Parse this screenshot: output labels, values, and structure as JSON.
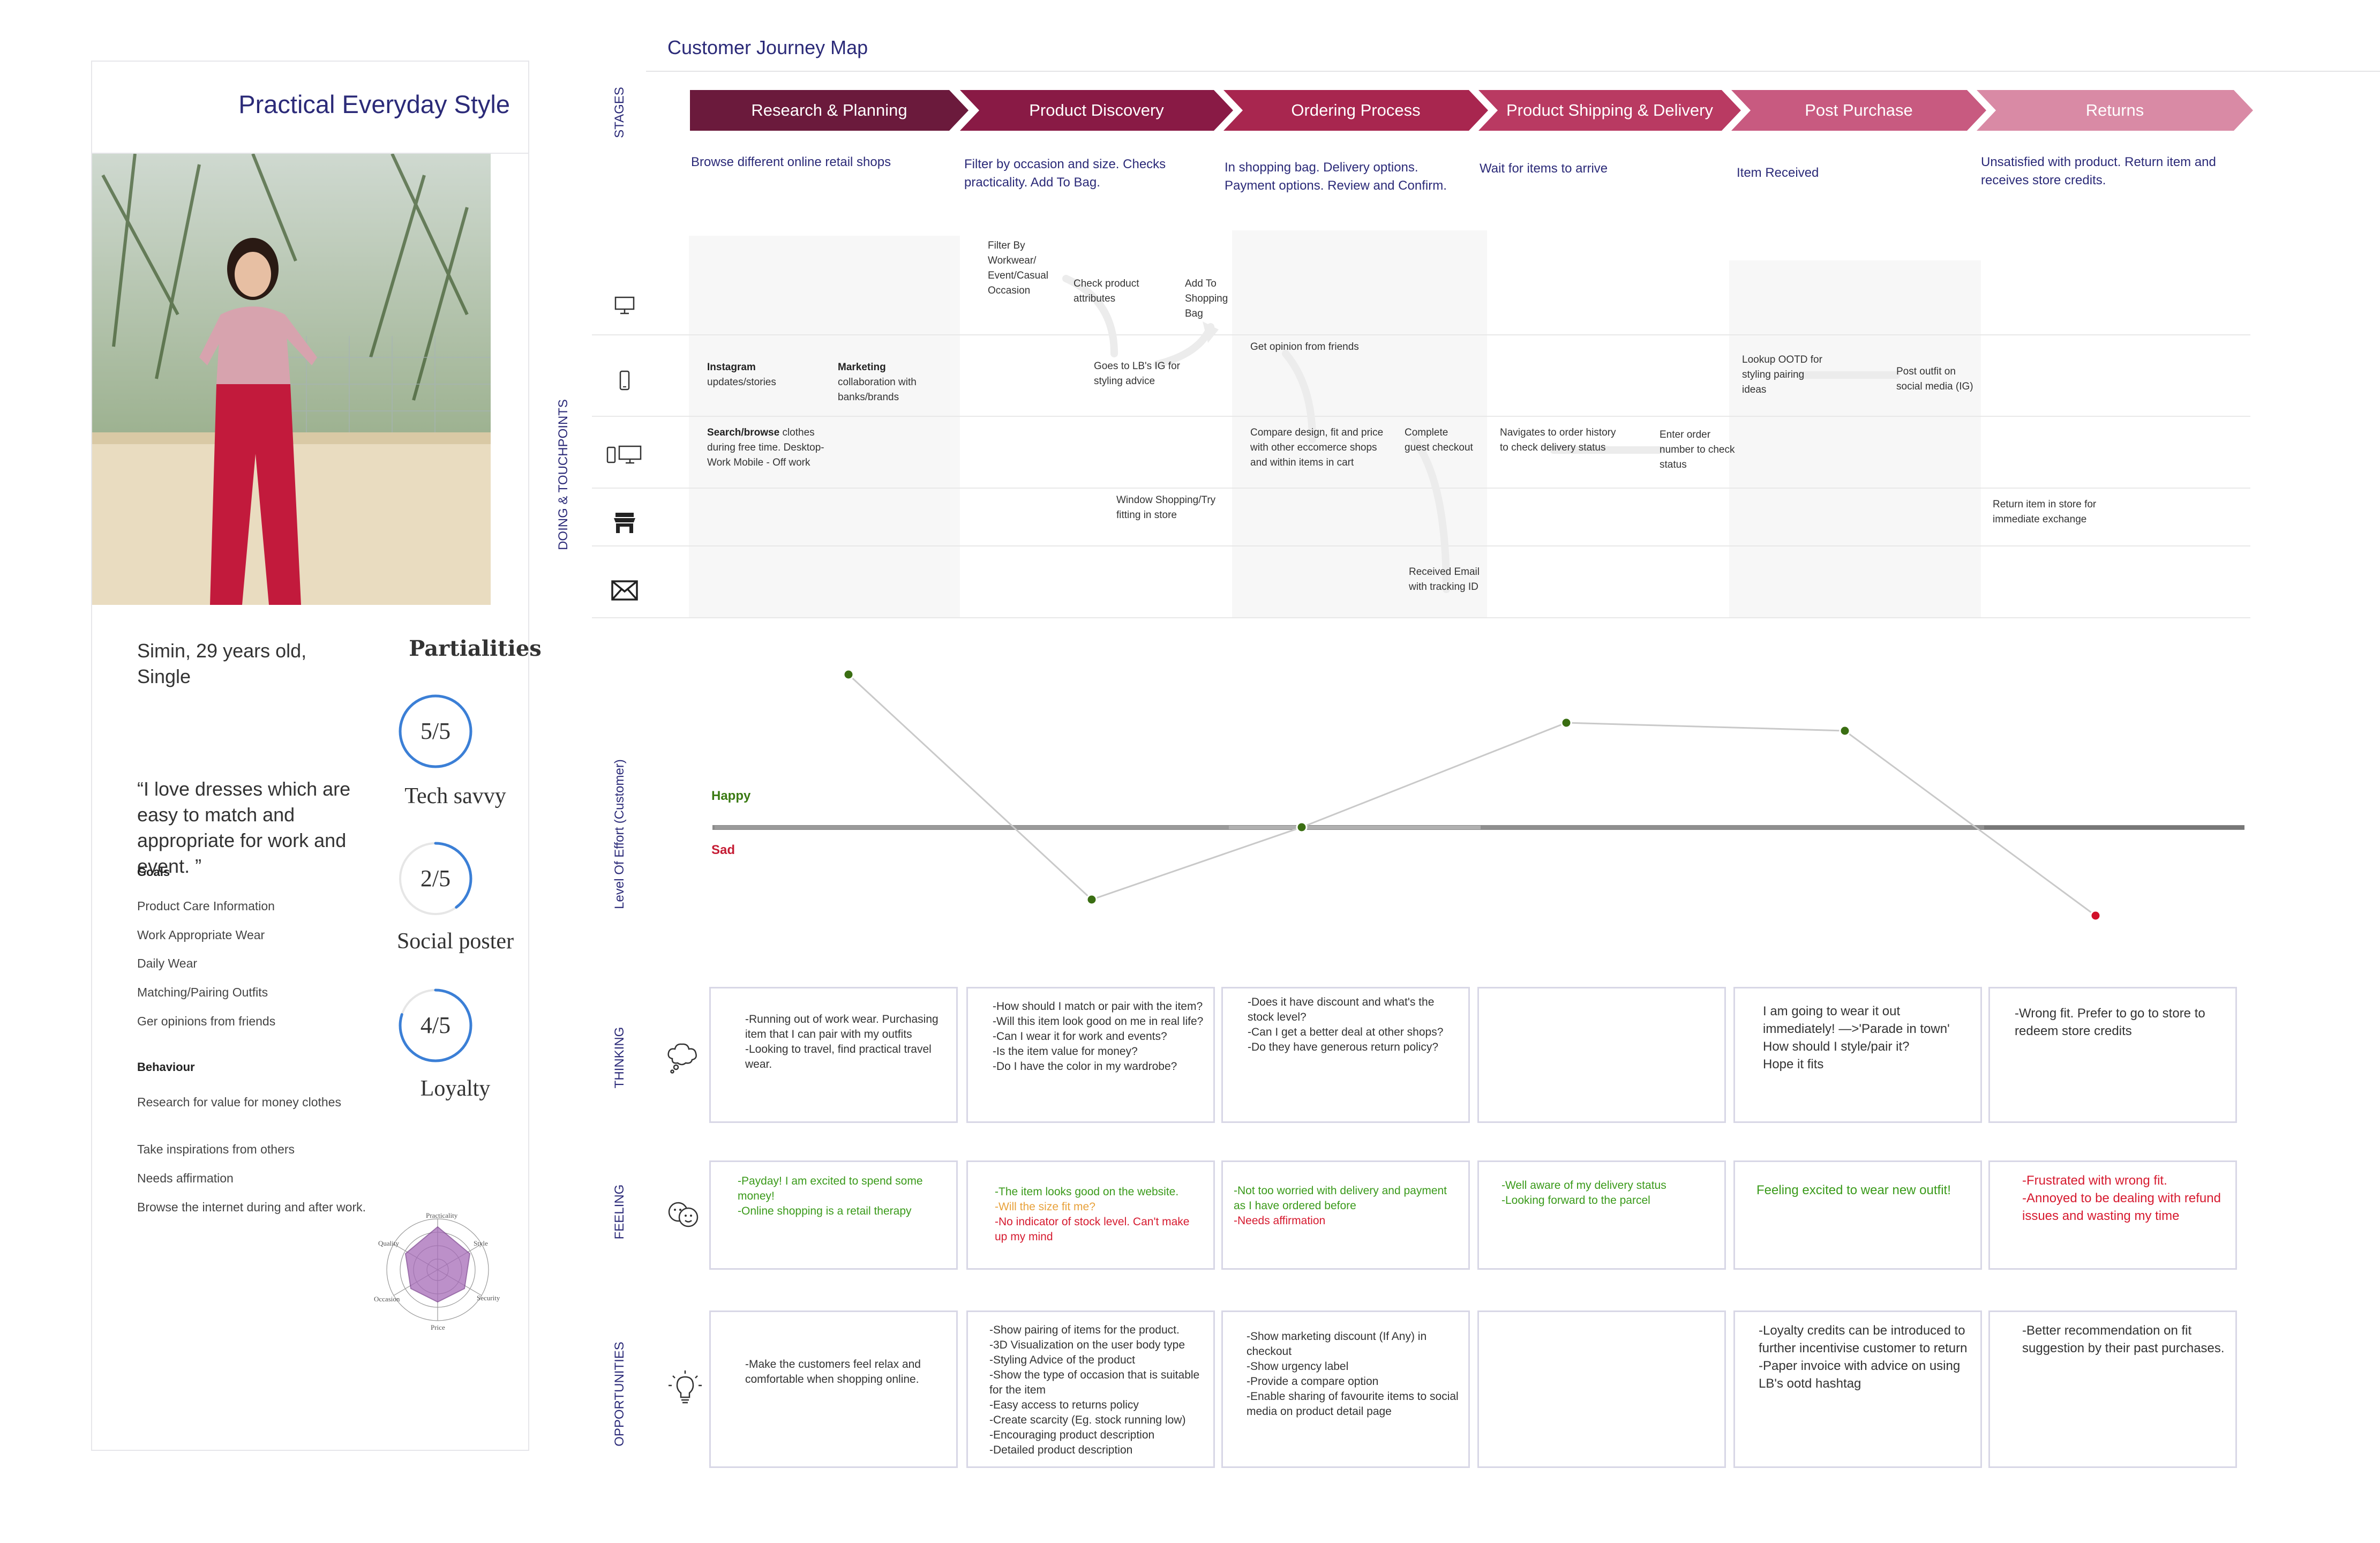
{
  "persona": {
    "title": "Practical Everyday Style",
    "name": "Simin, 29 years old, Single",
    "quote": "“I love dresses which are easy to match and appropriate for work and event. ”",
    "goals_heading": "Goals",
    "goals": [
      "Product Care Information",
      "Work Appropriate Wear",
      "Daily Wear",
      "Matching/Pairing Outfits",
      "Ger opinions from friends"
    ],
    "behaviour_heading": "Behaviour",
    "behaviours": [
      "Research for value for money clothes",
      "Take inspirations from others",
      "Needs affirmation",
      "Browse the internet during and after work."
    ],
    "partialities_title": "Partialities",
    "partialities": [
      {
        "score": "5/5",
        "label": "Tech savvy",
        "value": 1.0
      },
      {
        "score": "2/5",
        "label": "Social poster",
        "value": 0.4
      },
      {
        "score": "4/5",
        "label": "Loyalty",
        "value": 0.8
      }
    ],
    "radar_labels": [
      "Practicality",
      "Style",
      "Security",
      "Price",
      "Occasion",
      "Quality"
    ],
    "accent": "#3b7fd6"
  },
  "map": {
    "title": "Customer Journey Map",
    "row_labels": {
      "stages": "STAGES",
      "touchpoints": "DOING & TOUCHPOINTS",
      "effort": "Level Of Effort (Customer)",
      "thinking": "THINKING",
      "feeling": "FEELING",
      "opportunities": "OPPORTUNITIES"
    },
    "stages": [
      {
        "name": "Research & Planning",
        "color": "#6b1a3c",
        "desc": "Browse different online retail shops"
      },
      {
        "name": "Product Discovery",
        "color": "#891a45",
        "desc": "Filter by occasion and size. Checks practicality. Add To Bag."
      },
      {
        "name": "Ordering Process",
        "color": "#a8264f",
        "desc": "In shopping bag. Delivery options. Payment options. Review and Confirm."
      },
      {
        "name": "Product Shipping & Delivery",
        "color": "#b93a62",
        "desc": "Wait for items to arrive"
      },
      {
        "name": "Post Purchase",
        "color": "#c85a80",
        "desc": "Item Received"
      },
      {
        "name": "Returns",
        "color": "#d98aa5",
        "desc": "Unsatisfied with product. Return item and receives store credits."
      }
    ],
    "touchpoints": {
      "instagram_title": "Instagram",
      "instagram_text": "updates/stories",
      "marketing_title": "Marketing",
      "marketing_text": "collaboration with banks/brands",
      "search_title": "Search/browse",
      "search_text": "clothes during free time. Desktop- Work Mobile - Off work",
      "filter": "Filter By Workwear/ Event/Casual Occasion",
      "check_attr": "Check product attributes",
      "add_bag": "Add To Shopping Bag",
      "goes_ig": "Goes to LB's IG for styling advice",
      "window_shop": "Window Shopping/Try fitting in store",
      "opinion": "Get opinion from friends",
      "compare": "Compare design, fit and price with other eccomerce shops and within items in cart",
      "guest": "Complete guest checkout",
      "email": "Received Email with tracking ID",
      "navigate": "Navigates to order history to check delivery status",
      "order_num": "Enter order number to check status",
      "ootd": "Lookup OOTD for styling pairing ideas",
      "post_outfit": "Post outfit on social media (IG)",
      "return_store": "Return item in store for immediate exchange"
    },
    "emotion": {
      "happy_label": "Happy",
      "sad_label": "Sad",
      "points": [
        0.95,
        -0.45,
        0.0,
        0.65,
        0.6,
        -0.55
      ],
      "colors": {
        "positive": "#3a6e12",
        "negative": "#d1102a"
      }
    },
    "thinking": [
      "-Running out of work wear. Purchasing item that I can pair with my outfits\n-Looking to travel, find practical travel wear.",
      "-How should I match or pair with the item?\n-Will this item look good on me in real life?\n-Can I wear it for work and events?\n-Is the item value for money?\n-Do I have the color in my wardrobe?",
      "-Does it have discount and what's the stock level?\n-Can I get a better deal at other shops?\n-Do they have generous return policy?",
      "",
      "I am going to wear it out immediately! —>'Parade in town'\nHow should I style/pair it?\nHope it fits",
      "-Wrong fit. Prefer to go to store to redeem store credits"
    ],
    "feeling": [
      {
        "lines": [
          {
            "t": "-Payday! I am excited to spend some money!\n-Online shopping is a retail therapy",
            "c": "green"
          }
        ]
      },
      {
        "lines": [
          {
            "t": "-The item looks good on the website.",
            "c": "green"
          },
          {
            "t": "-Will the size fit me?",
            "c": "orange"
          },
          {
            "t": "-No indicator of stock level. Can't make up my mind",
            "c": "red"
          }
        ]
      },
      {
        "lines": [
          {
            "t": "-Not too worried with delivery and payment as I have ordered before",
            "c": "green"
          },
          {
            "t": "-Needs affirmation",
            "c": "red"
          }
        ]
      },
      {
        "lines": [
          {
            "t": "-Well aware of my delivery status\n-Looking forward to the parcel",
            "c": "green"
          }
        ]
      },
      {
        "lines": [
          {
            "t": "Feeling excited to wear new outfit!",
            "c": "green"
          }
        ]
      },
      {
        "lines": [
          {
            "t": "-Frustrated with wrong fit.\n-Annoyed to be dealing with refund issues and wasting my time",
            "c": "red"
          }
        ]
      }
    ],
    "opportunities": [
      "-Make the customers feel relax and comfortable when shopping online.",
      "-Show pairing of items for the product.\n-3D Visualization on the user body type\n-Styling Advice of the product\n-Show the type of occasion that is suitable for the item\n-Easy access to returns policy\n-Create scarcity (Eg. stock running low)\n-Encouraging product description\n-Detailed product description",
      "-Show marketing discount (If Any) in checkout\n-Show urgency label\n-Provide a compare option\n-Enable sharing of favourite items to social media on product detail page",
      "",
      "-Loyalty credits can be introduced to further incentivise customer to return\n-Paper invoice with advice on using LB's ootd hashtag",
      "-Better recommendation on fit suggestion by their past purchases."
    ],
    "icons": [
      "desktop-icon",
      "mobile-icon",
      "mobile-desktop-icon",
      "store-icon",
      "mail-icon",
      "thought-cloud-icon",
      "faces-icon",
      "lightbulb-icon"
    ]
  }
}
